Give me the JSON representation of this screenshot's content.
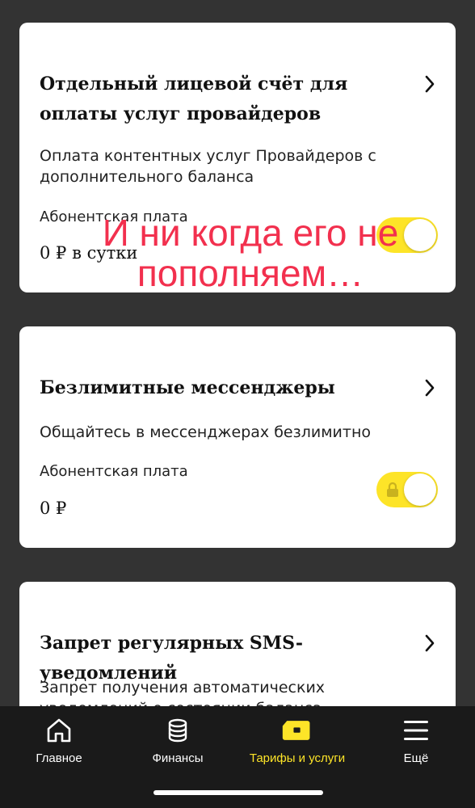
{
  "cards": [
    {
      "title": "Отдельный лицевой счёт для оплаты услуг провайдеров",
      "description": "Оплата контентных услуг Провайдеров с дополнительного баланса",
      "fee_label": "Абонентская плата",
      "fee_value": "0 ₽ в сутки",
      "toggle_on": true
    },
    {
      "title": "Безлимитные мессенджеры",
      "description": "Общайтесь в мессенджерах безлимитно",
      "fee_label": "Абонентская плата",
      "fee_value": "0 ₽",
      "toggle_on": true,
      "toggle_locked": true
    },
    {
      "title": "Запрет регулярных SMS-уведомлений",
      "description": "Запрет получения автоматических уведомлений о состоянии баланса"
    }
  ],
  "overlay_caption": "И ни когда его не пополняем…",
  "tabbar": {
    "items": [
      {
        "label": "Главное",
        "icon": "home-icon",
        "active": false
      },
      {
        "label": "Финансы",
        "icon": "coins-icon",
        "active": false
      },
      {
        "label": "Тарифы и услуги",
        "icon": "sim-card-icon",
        "active": true
      },
      {
        "label": "Ещё",
        "icon": "menu-icon",
        "active": false
      }
    ]
  },
  "colors": {
    "background": "#333333",
    "accent": "#fde428",
    "overlay_text": "#f2304e",
    "tabbar": "#1a1a1a"
  }
}
